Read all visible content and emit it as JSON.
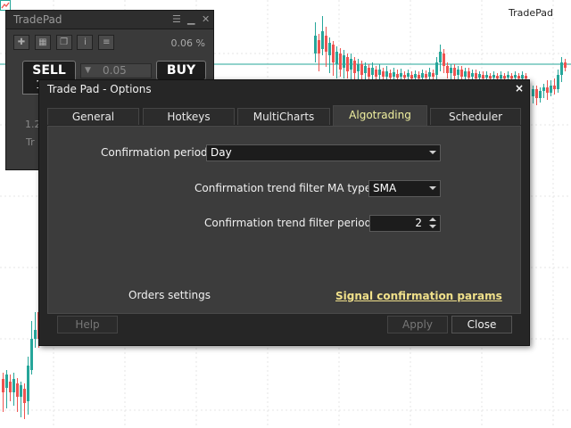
{
  "brand": {
    "label": "TradePad"
  },
  "tradepad": {
    "title": "TradePad",
    "percent": "0.06 %",
    "sell_label": "SELL",
    "buy_label": "BUY",
    "volume_value": "0.05",
    "sell_digit": "1",
    "small_value_1": "1.2",
    "small_value_2": "Tr"
  },
  "dialog": {
    "title": "Trade Pad - Options",
    "close_glyph": "×",
    "tabs": [
      {
        "label": "General"
      },
      {
        "label": "Hotkeys"
      },
      {
        "label": "MultiCharts"
      },
      {
        "label": "Algotrading"
      },
      {
        "label": "Scheduler"
      }
    ],
    "active_tab": "Algotrading",
    "fields": {
      "confirmation_period": {
        "label": "Confirmation period:",
        "value": "Day"
      },
      "ma_type": {
        "label": "Confirmation trend filter MA type:",
        "value": "SMA"
      },
      "filter_period": {
        "label": "Confirmation trend filter period:",
        "value": "2"
      }
    },
    "orders_settings_label": "Orders settings",
    "signal_link_label": "Signal confirmation params",
    "buttons": {
      "help": "Help",
      "apply": "Apply",
      "close": "Close"
    }
  },
  "colors": {
    "bull_candle": "#26a69a",
    "bear_candle": "#ef5350",
    "level_line": "#26a69a",
    "dialog_bg": "#262626",
    "panel_bg": "#3c3c3c",
    "active_tab_text": "#f0f0a0",
    "link_text": "#f0e08a"
  }
}
